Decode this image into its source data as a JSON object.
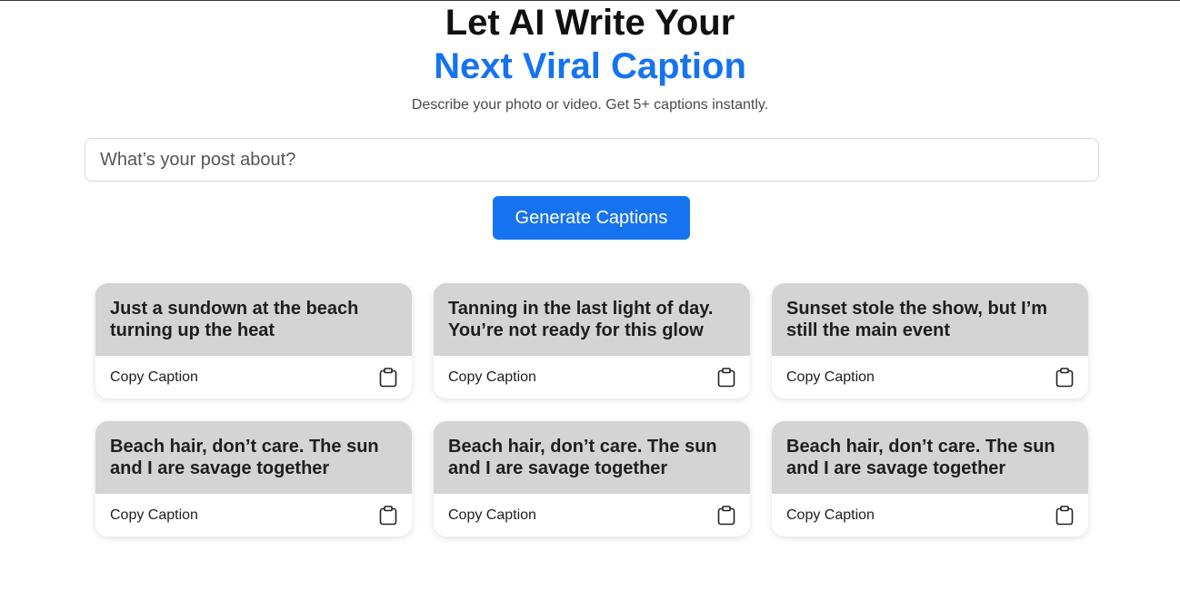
{
  "hero": {
    "title_line1": "Let AI Write Your",
    "title_line2": "Next Viral Caption",
    "subtitle": "Describe your photo or video. Get 5+ captions instantly.",
    "accent_color": "#1673f0"
  },
  "form": {
    "input_placeholder": "What’s your post about?",
    "input_value": "",
    "generate_label": "Generate Captions"
  },
  "cards": [
    {
      "caption": "Just a sundown at the beach turning up the heat",
      "copy_label": "Copy Caption",
      "icon": "clipboard-icon"
    },
    {
      "caption": "Tanning in the last light of day. You’re not ready for this glow",
      "copy_label": "Copy Caption",
      "icon": "clipboard-icon"
    },
    {
      "caption": "Sunset stole the show, but I’m still the main event",
      "copy_label": "Copy Caption",
      "icon": "clipboard-icon"
    },
    {
      "caption": "Beach hair, don’t care. The sun and I are savage together",
      "copy_label": "Copy Caption",
      "icon": "clipboard-icon"
    },
    {
      "caption": "Beach hair, don’t care. The sun and I are savage together",
      "copy_label": "Copy Caption",
      "icon": "clipboard-icon"
    },
    {
      "caption": "Beach hair, don’t care. The sun and I are savage together",
      "copy_label": "Copy Caption",
      "icon": "clipboard-icon"
    }
  ]
}
